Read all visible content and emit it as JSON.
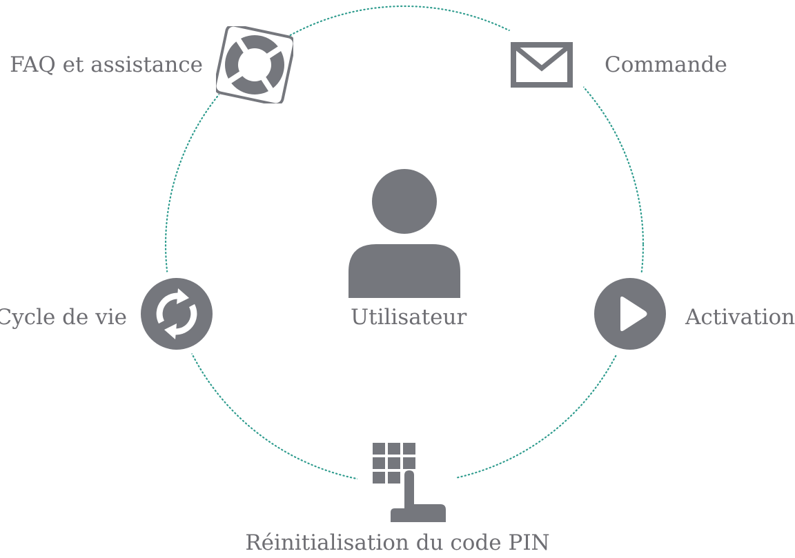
{
  "center": {
    "label": "Utilisateur",
    "icon": "user-icon"
  },
  "nodes": {
    "faq": {
      "label": "FAQ et assistance",
      "icon": "lifebuoy-icon"
    },
    "commande": {
      "label": "Commande",
      "icon": "envelope-icon"
    },
    "activation": {
      "label": "Activation",
      "icon": "play-icon"
    },
    "pin": {
      "label": "Réinitialisation du code PIN",
      "icon": "keypad-icon"
    },
    "cycle": {
      "label": "Cycle de vie",
      "icon": "refresh-icon"
    }
  },
  "colors": {
    "icon": "#75777d",
    "text": "#6e6e73",
    "orbit": "#2f9c8e",
    "background": "#ffffff"
  }
}
